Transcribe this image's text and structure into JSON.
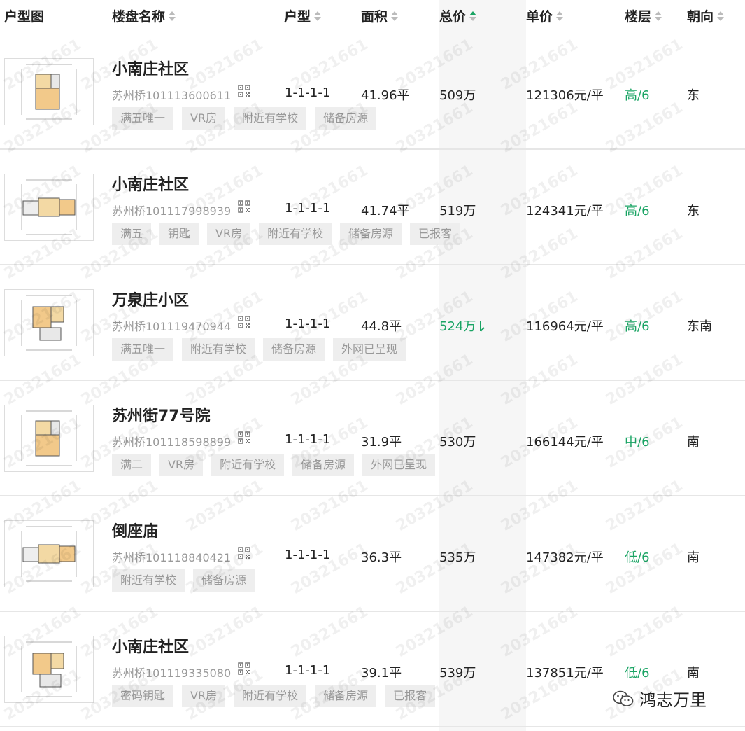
{
  "header": {
    "floorplan": "户型图",
    "name": "楼盘名称",
    "layout": "户型",
    "area": "面积",
    "total": "总价",
    "unit": "单价",
    "floor": "楼层",
    "orientation": "朝向"
  },
  "rows": [
    {
      "name": "小南庄社区",
      "code": "苏州桥101113600611",
      "layout": "1-1-1-1",
      "area": "41.96平",
      "total": "509万",
      "unit": "121306元/平",
      "floor": "高/6",
      "orientation": "东",
      "tags": [
        "满五唯一",
        "VR房",
        "附近有学校",
        "储备房源"
      ]
    },
    {
      "name": "小南庄社区",
      "code": "苏州桥101117998939",
      "layout": "1-1-1-1",
      "area": "41.74平",
      "total": "519万",
      "unit": "124341元/平",
      "floor": "高/6",
      "orientation": "东",
      "tags": [
        "满五",
        "钥匙",
        "VR房",
        "附近有学校",
        "储备房源",
        "已报客"
      ]
    },
    {
      "name": "万泉庄小区",
      "code": "苏州桥101119470944",
      "layout": "1-1-1-1",
      "area": "44.8平",
      "total": "524万",
      "unit": "116964元/平",
      "floor": "高/6",
      "orientation": "东南",
      "price_down": true,
      "tags": [
        "满五唯一",
        "附近有学校",
        "储备房源",
        "外网已呈现"
      ]
    },
    {
      "name": "苏州街77号院",
      "code": "苏州桥101118598899",
      "layout": "1-1-1-1",
      "area": "31.9平",
      "total": "530万",
      "unit": "166144元/平",
      "floor": "中/6",
      "orientation": "南",
      "tags": [
        "满二",
        "VR房",
        "附近有学校",
        "储备房源",
        "外网已呈现"
      ]
    },
    {
      "name": "倒座庙",
      "code": "苏州桥101118840421",
      "layout": "1-1-1-1",
      "area": "36.3平",
      "total": "535万",
      "unit": "147382元/平",
      "floor": "低/6",
      "orientation": "南",
      "tags": [
        "附近有学校",
        "储备房源"
      ]
    },
    {
      "name": "小南庄社区",
      "code": "苏州桥101119335080",
      "layout": "1-1-1-1",
      "area": "39.1平",
      "total": "539万",
      "unit": "137851元/平",
      "floor": "低/6",
      "orientation": "南",
      "tags": [
        "密码钥匙",
        "VR房",
        "附近有学校",
        "储备房源",
        "已报客"
      ]
    }
  ],
  "watermark": "20321661",
  "brand": {
    "text": "鸿志万里",
    "icon": "wechat-official-account-icon"
  },
  "colors": {
    "green": "#1aa464",
    "tag_bg": "#eeeeee",
    "tag_text": "#999999"
  }
}
